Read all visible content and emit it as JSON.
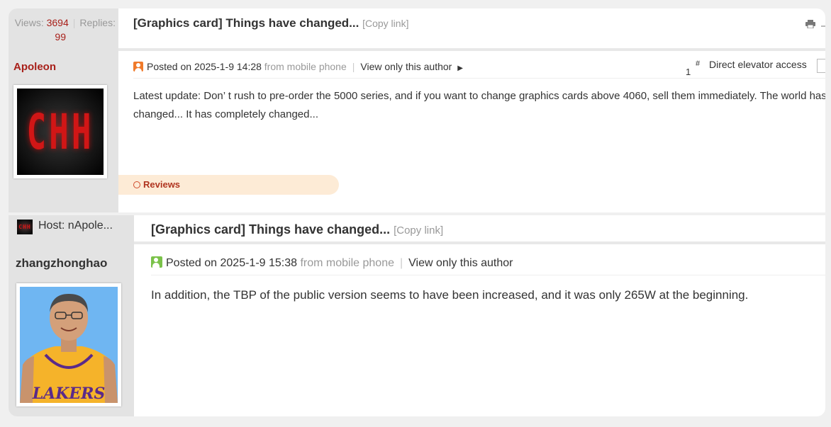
{
  "post1": {
    "stats": {
      "views_label": "Views: ",
      "views": "3694",
      "replies_label": "Replies: ",
      "replies": "99"
    },
    "title": "[Graphics card] Things have changed...",
    "copy_link": "[Copy link]",
    "author": "Apoleon",
    "avatar_text": "CHH",
    "meta": {
      "posted": "Posted on 2025-1-9 14:28",
      "source": "from mobile phone",
      "view_only": "View only this author",
      "floor": "1",
      "floor_mark": "#",
      "elevator": "Direct elevator access"
    },
    "body": "Latest update: Don’ t rush to pre-order the 5000 series, and if you want to change graphics cards above 4060, sell them immediately. The world has changed... It has completely changed...",
    "reviews": "Reviews"
  },
  "post2": {
    "host_label": "Host: nApole...",
    "host_avatar_text": "CHH",
    "title": "[Graphics card] Things have changed...",
    "copy_link": "[Copy link]",
    "author": "zhangzhonghao",
    "meta": {
      "posted": "Posted on 2025-1-9 15:38",
      "source": "from mobile phone",
      "view_only": "View only this author"
    },
    "body": "In addition, the TBP of the public version seems to have been increased, and it was only 265W at the beginning.",
    "jersey_text": "LAKERS"
  },
  "colors": {
    "accent_red": "#a8201a",
    "badge_orange": "#f07a2a",
    "badge_green": "#7bc24a",
    "reviews_bg": "#fdebd6"
  }
}
